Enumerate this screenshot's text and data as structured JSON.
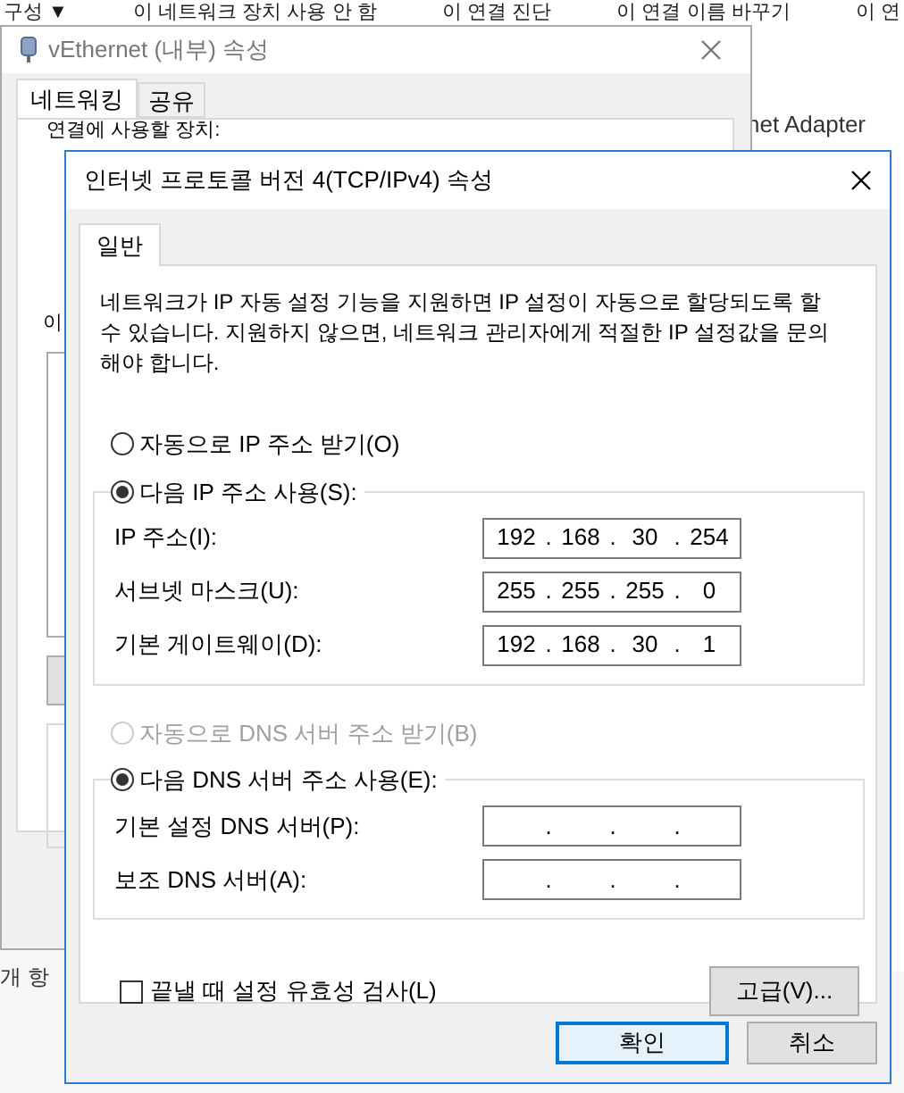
{
  "background_toolbar": [
    "구성 ▼",
    "이 네트워크 장치 사용 안 함",
    "이 연결 진단",
    "이 연결 이름 바꾸기",
    "이 연"
  ],
  "background_adapter_label": "net Adapter",
  "status_text": "개 항",
  "back_dialog": {
    "title": "vEthernet (내부) 속성",
    "tabs": [
      {
        "label": "네트워킹",
        "selected": true
      },
      {
        "label": "공유",
        "selected": false
      }
    ],
    "device_label": "연결에 사용할 장치:",
    "items_label": "이"
  },
  "dialog": {
    "title": "인터넷 프로토콜 버전 4(TCP/IPv4) 속성",
    "tabs": [
      {
        "label": "일반",
        "selected": true
      }
    ],
    "description": "네트워크가 IP 자동 설정 기능을 지원하면 IP 설정이 자동으로 할당되도록 할 수 있습니다. 지원하지 않으면, 네트워크 관리자에게 적절한 IP 설정값을 문의해야 합니다.",
    "separator": ".",
    "ip_mode": [
      {
        "label": "자동으로 IP 주소 받기(O)",
        "selected": false,
        "disabled": false
      },
      {
        "label": "다음 IP 주소 사용(S):",
        "selected": true,
        "disabled": false
      }
    ],
    "ip_fields": [
      {
        "label": "IP 주소(I):",
        "octets": [
          "192",
          "168",
          "30",
          "254"
        ]
      },
      {
        "label": "서브넷 마스크(U):",
        "octets": [
          "255",
          "255",
          "255",
          "0"
        ]
      },
      {
        "label": "기본 게이트웨이(D):",
        "octets": [
          "192",
          "168",
          "30",
          "1"
        ]
      }
    ],
    "dns_mode": [
      {
        "label": "자동으로 DNS 서버 주소 받기(B)",
        "selected": false,
        "disabled": true
      },
      {
        "label": "다음 DNS 서버 주소 사용(E):",
        "selected": true,
        "disabled": false
      }
    ],
    "dns_fields": [
      {
        "label": "기본 설정 DNS 서버(P):"
      },
      {
        "label": "보조 DNS 서버(A):"
      }
    ],
    "validate": {
      "label": "끝낼 때 설정 유효성 검사(L)",
      "checked": false
    },
    "advanced_button": "고급(V)...",
    "buttons": [
      {
        "label": "확인",
        "default": true
      },
      {
        "label": "취소",
        "default": false
      }
    ]
  }
}
